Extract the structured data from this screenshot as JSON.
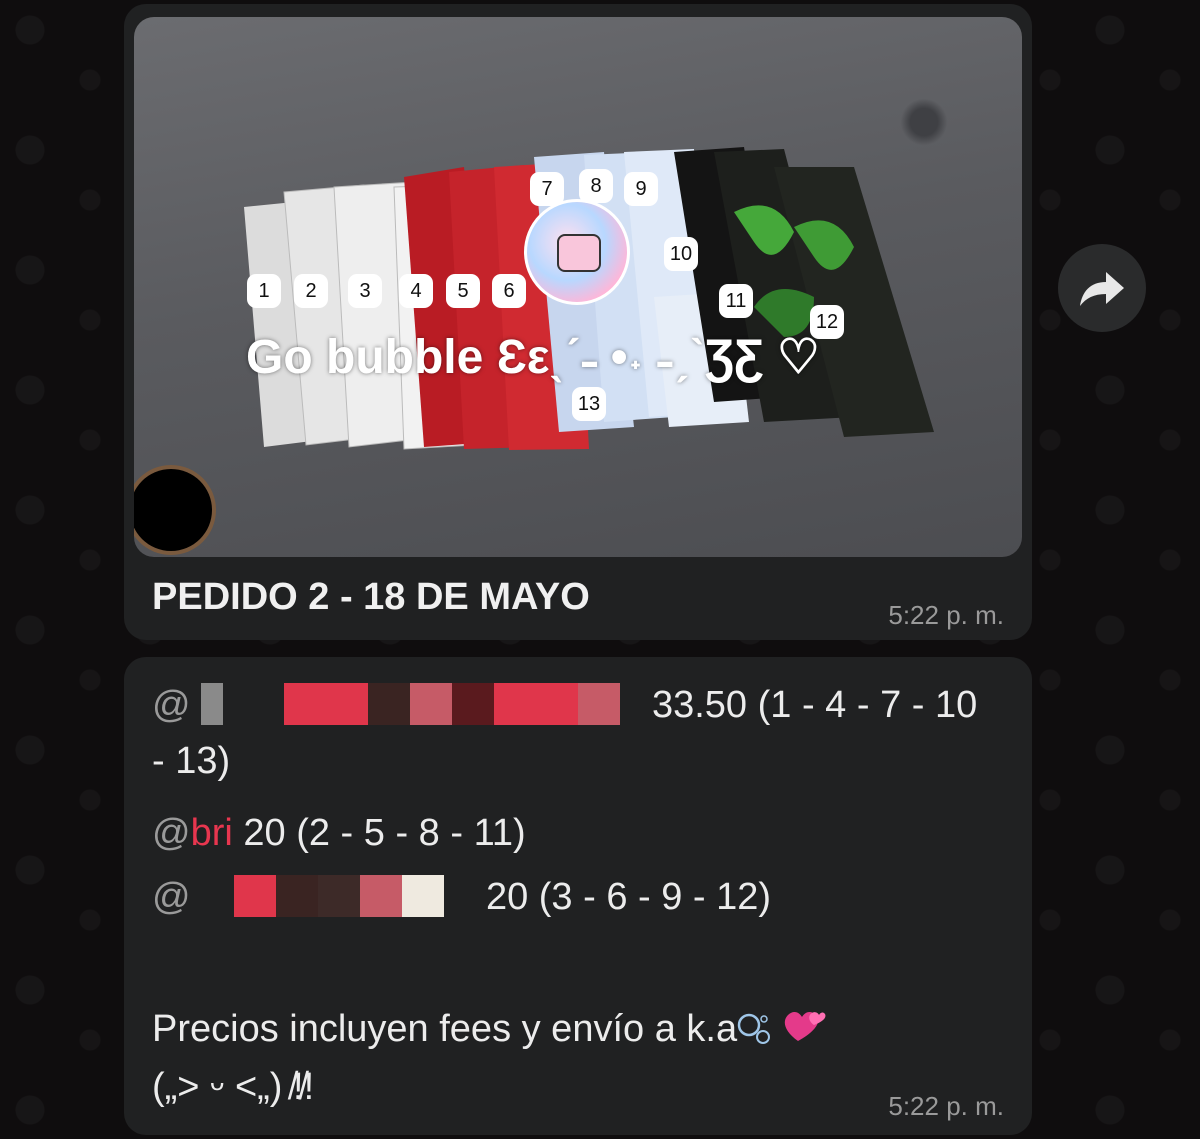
{
  "photo": {
    "labels": [
      "1",
      "2",
      "3",
      "4",
      "5",
      "6",
      "7",
      "8",
      "9",
      "10",
      "11",
      "12",
      "13"
    ],
    "watermark": "Go bubble Ɛεˎˊ˗ •˖ ˗ˏˋƷƸ ♡"
  },
  "message1": {
    "caption": "PEDIDO 2 - 18 DE MAYO",
    "time": "5:22 p. m."
  },
  "message2": {
    "line1": {
      "at": "@",
      "text": "33.50 (1 - 4 - 7 - 10",
      "wrap": "- 13)"
    },
    "line2": {
      "at": "@",
      "user": "bri",
      "text": "20 (2 - 5 - 8 - 11)"
    },
    "line3": {
      "at": "@",
      "text": "20 (3 - 6 - 9 - 12)"
    },
    "note": "Precios incluyen fees y envío a k.a",
    "kaomoji": "(„> ᵕ <„) ̸!̸!",
    "time": "5:22 p. m."
  }
}
